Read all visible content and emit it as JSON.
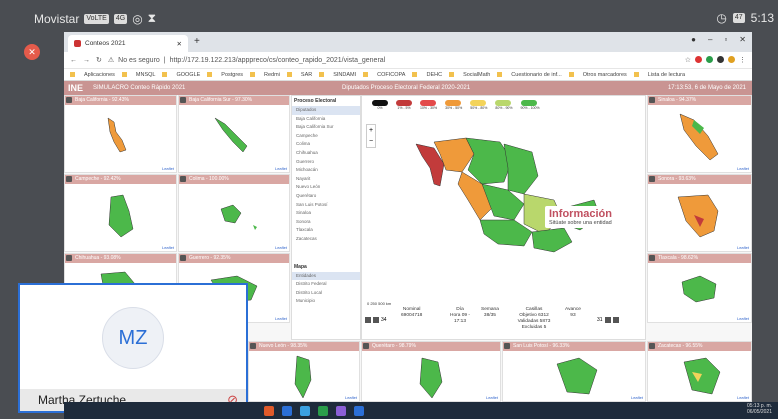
{
  "phone_status": {
    "carrier": "Movistar",
    "volte_badge": "VoLTE",
    "signal_label": "4G",
    "battery": "47",
    "time": "5:13"
  },
  "browser": {
    "tab_title": "Conteos 2021",
    "url_security": "No es seguro",
    "url": "http://172.19.122.213/apppreco/cs/conteo_rapido_2021/vista_general",
    "bookmarks": [
      "Aplicaciones",
      "MNSQL",
      "GOOGLE",
      "Postgres",
      "Redmi",
      "SAR",
      "SINDAMI",
      "COFICOPA",
      "DEHC",
      "SocialMath",
      "Cuestionario de inf...",
      "Otros marcadores",
      "Lista de lectura"
    ]
  },
  "app": {
    "logo": "INE",
    "title": "SIMULACRO Conteo Rápido 2021",
    "map_title": "Diputados Proceso Electoral Federal 2020-2021",
    "datetime": "17:13:53, 6 de Mayo de 2021"
  },
  "panels": {
    "baja_california": "Baja California - 92.43%",
    "baja_california_sur": "Baja California Sur - 97.30%",
    "sinaloa": "Sinaloa - 94.37%",
    "campeche": "Campeche - 92.42%",
    "colima": "Colima - 100.00%",
    "sonora": "Sonora - 93.63%",
    "chihuahua": "Chihuahua - 93.08%",
    "guerrero": "Guerrero - 92.35%",
    "tlaxcala": "Tlaxcala - 98.62%",
    "nuevo_leon": "Nuevo León - 98.35%",
    "queretaro": "Querétaro - 98.79%",
    "san_luis_potosi": "San Luis Potosí - 96.33%",
    "zacatecas": "Zacatecas - 96.55%",
    "leaflet": "Leaflet"
  },
  "sidebar": {
    "process_header": "Proceso Electoral",
    "process_items": [
      "Diputados",
      "Baja California",
      "Baja California Sur",
      "Campeche",
      "Colima",
      "Chihuahua",
      "Guerrero",
      "Michoacán",
      "Nayarit",
      "Nuevo León",
      "Querétaro",
      "San Luis Potosí",
      "Sinaloa",
      "Sonora",
      "Tlaxcala",
      "Zacatecas"
    ],
    "map_header": "Mapa",
    "map_items": [
      "Entidades",
      "Distrito Federal",
      "Distrito Local",
      "Municipio"
    ]
  },
  "legend": [
    {
      "label": "0%",
      "color": "#111111"
    },
    {
      "label": "1% - 5%",
      "color": "#c23b3b"
    },
    {
      "label": "10% - 30%",
      "color": "#e34a4a"
    },
    {
      "label": "30% - 50%",
      "color": "#ef9a3a"
    },
    {
      "label": "50% - 80%",
      "color": "#f3d35a"
    },
    {
      "label": "80% - 90%",
      "color": "#b9d76c"
    },
    {
      "label": "90% - 100%",
      "color": "#4cb84a"
    }
  ],
  "zoom": {
    "plus": "+",
    "minus": "−"
  },
  "info": {
    "title": "Información",
    "subtitle": "Sitúate sobre una entidad"
  },
  "scale": "0   250   500 km",
  "stats": {
    "nominal_label": "Nominal",
    "nominal_value": "69004718",
    "dia_label": "Día",
    "dia_value": "Hora 09 - 17:13",
    "semana_label": "Semana",
    "semana_value": "38/35",
    "casillas_label": "Casillas",
    "casillas_value": "Objetivo 6312 Validadas 5873 Excluidas 5",
    "avance_label": "Avance",
    "avance_value": "93",
    "page_left": "34",
    "page_right": "31"
  },
  "video": {
    "initials": "MZ",
    "name": "Martha Zertuche"
  },
  "clock": {
    "time": "05:13 p. m.",
    "date": "06/05/2021"
  }
}
